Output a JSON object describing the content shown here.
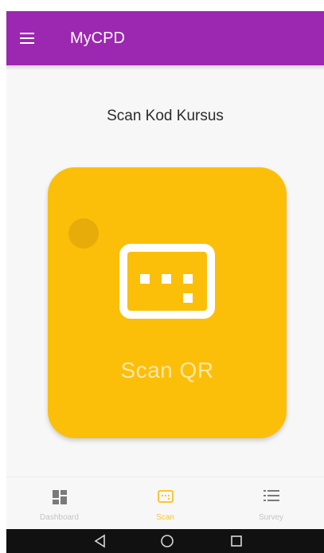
{
  "app_bar": {
    "title": "MyCPD",
    "background_color": "#9c27b0",
    "menu_icon": "hamburger-menu-icon"
  },
  "main": {
    "heading": "Scan Kod Kursus",
    "scan_card": {
      "label": "Scan QR",
      "icon": "qr-scan-icon",
      "background_color": "#fbbf0a"
    }
  },
  "bottom_nav": {
    "active_color": "#fbc634",
    "items": [
      {
        "label": "Dashboard",
        "icon": "dashboard-icon",
        "active": false
      },
      {
        "label": "Scan",
        "icon": "scan-icon",
        "active": true
      },
      {
        "label": "Survey",
        "icon": "list-icon",
        "active": false
      }
    ]
  },
  "system_nav": {
    "buttons": [
      "back-icon",
      "home-icon",
      "recents-icon"
    ]
  }
}
